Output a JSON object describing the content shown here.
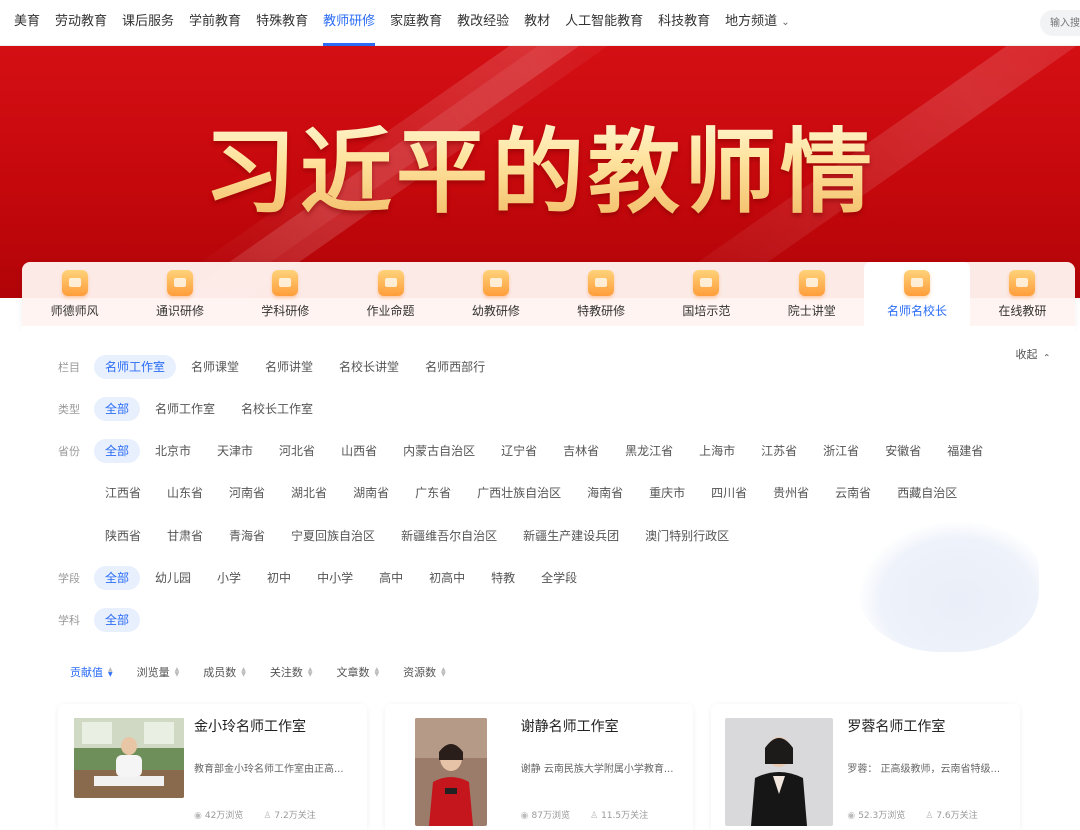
{
  "nav": {
    "items": [
      "美育",
      "劳动教育",
      "课后服务",
      "学前教育",
      "特殊教育",
      "教师研修",
      "家庭教育",
      "教改经验",
      "教材",
      "人工智能教育",
      "科技教育",
      "地方频道"
    ],
    "active_index": 5,
    "search_placeholder": "输入搜"
  },
  "banner": {
    "title": "习近平的教师情"
  },
  "tabs": {
    "items": [
      "师德师风",
      "通识研修",
      "学科研修",
      "作业命题",
      "幼教研修",
      "特教研修",
      "国培示范",
      "院士讲堂",
      "名师名校长",
      "在线教研"
    ],
    "active_index": 8
  },
  "filters": {
    "collapse_label": "收起",
    "lanmu": {
      "label": "栏目",
      "options": [
        "名师工作室",
        "名师课堂",
        "名师讲堂",
        "名校长讲堂",
        "名师西部行"
      ]
    },
    "leixing": {
      "label": "类型",
      "options": [
        "全部",
        "名师工作室",
        "名校长工作室"
      ]
    },
    "shengfen": {
      "label": "省份",
      "row1": [
        "全部",
        "北京市",
        "天津市",
        "河北省",
        "山西省",
        "内蒙古自治区",
        "辽宁省",
        "吉林省",
        "黑龙江省",
        "上海市",
        "江苏省",
        "浙江省",
        "安徽省",
        "福建省"
      ],
      "row2": [
        "江西省",
        "山东省",
        "河南省",
        "湖北省",
        "湖南省",
        "广东省",
        "广西壮族自治区",
        "海南省",
        "重庆市",
        "四川省",
        "贵州省",
        "云南省",
        "西藏自治区"
      ],
      "row3": [
        "陕西省",
        "甘肃省",
        "青海省",
        "宁夏回族自治区",
        "新疆维吾尔自治区",
        "新疆生产建设兵团",
        "澳门特别行政区"
      ]
    },
    "xueduan": {
      "label": "学段",
      "options": [
        "全部",
        "幼儿园",
        "小学",
        "初中",
        "中小学",
        "高中",
        "初高中",
        "特教",
        "全学段"
      ]
    },
    "xueke": {
      "label": "学科",
      "options": [
        "全部"
      ]
    }
  },
  "sort": {
    "items": [
      "贡献值",
      "浏览量",
      "成员数",
      "关注数",
      "文章数",
      "资源数"
    ],
    "active_index": 0
  },
  "cards": [
    {
      "name": "金小玲名师工作室",
      "desc": "教育部金小玲名师工作室由正高...",
      "views": "42万浏览",
      "follows": "7.2万关注"
    },
    {
      "name": "谢静名师工作室",
      "desc": "谢静 云南民族大学附属小学教育...",
      "views": "87万浏览",
      "follows": "11.5万关注"
    },
    {
      "name": "罗蓉名师工作室",
      "desc": "罗蓉： 正高级教师，云南省特级...",
      "views": "52.3万浏览",
      "follows": "7.6万关注"
    }
  ],
  "colors": {
    "accent": "#2a6cf6",
    "banner_red": "#c8080c",
    "chip_bg": "#e8effd"
  }
}
